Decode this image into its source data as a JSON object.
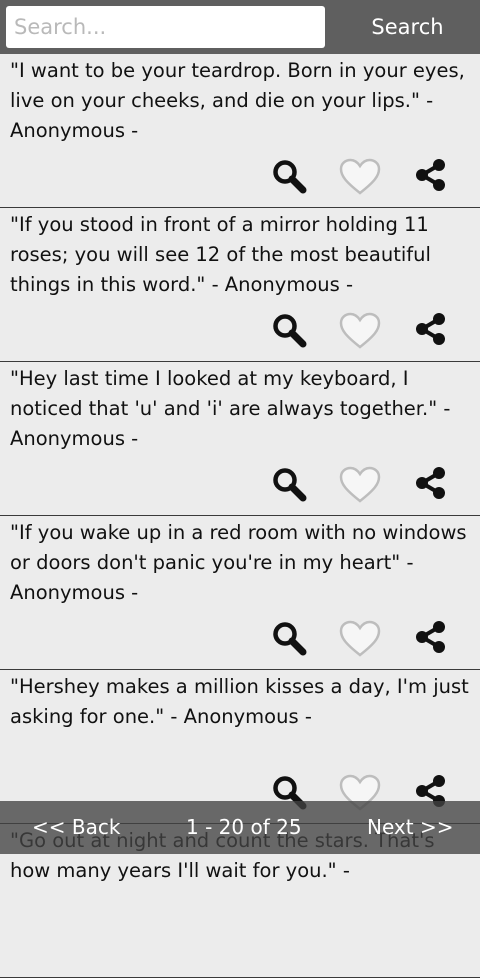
{
  "search": {
    "placeholder": "Search...",
    "value": "",
    "button_label": "Search"
  },
  "quotes": [
    {
      "text": "\"I want to be your teardrop. Born in your eyes, live on your cheeks, and die on your lips.\" - Anonymous -"
    },
    {
      "text": "\"If you stood in front of a mirror holding 11 roses; you will see 12 of the most beautiful things in this word.\" - Anonymous -"
    },
    {
      "text": "\"Hey last time I looked at my keyboard, I noticed that 'u' and 'i' are always together.\" - Anonymous -"
    },
    {
      "text": "\"If you wake up in a red room with no windows or doors don't panic you're in my heart\" - Anonymous -"
    },
    {
      "text": "\"Hershey makes a million kisses a day, I'm just asking for one.\" - Anonymous -"
    },
    {
      "text": "\"Go out at night and count the stars. That's how many years I'll wait for you.\" -"
    }
  ],
  "item_icons": [
    "search-icon",
    "heart-icon",
    "share-icon"
  ],
  "pagination": {
    "back_label": "<< Back",
    "page_label": "1 - 20 of 25",
    "next_label": "Next >>"
  },
  "colors": {
    "topbar": "#5f5f5f",
    "background": "#ececec",
    "bottombar": "#424242",
    "heart_outline": "#bdbdbd",
    "icon": "#111111"
  }
}
